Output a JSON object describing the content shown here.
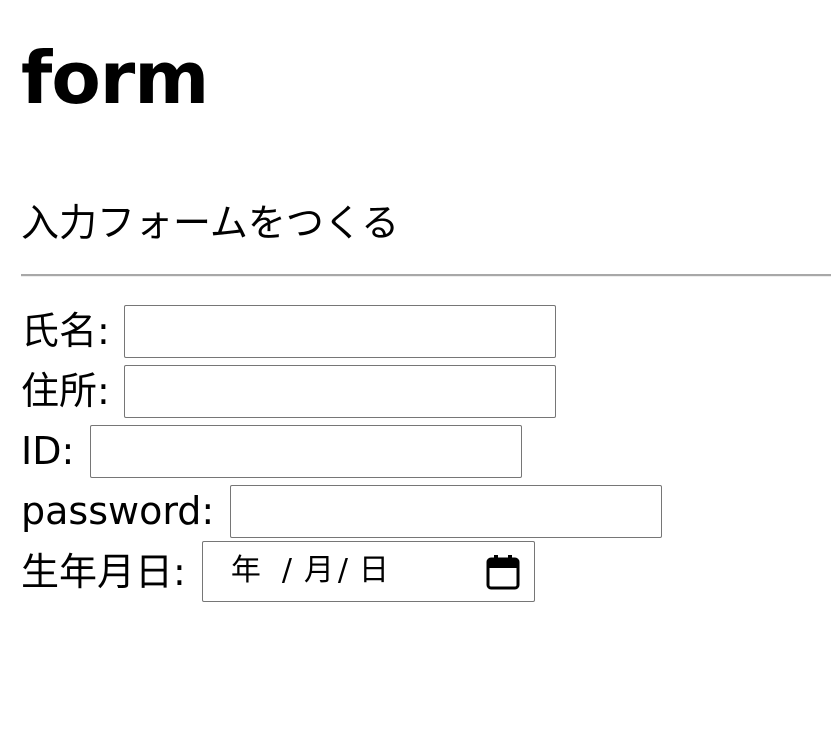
{
  "heading": "form",
  "subtitle": "入力フォームをつくる",
  "form": {
    "name_label": "氏名:",
    "address_label": "住所:",
    "id_label": "ID:",
    "password_label": "password:",
    "birthdate_label": "生年月日:",
    "name_value": "",
    "address_value": "",
    "id_value": "",
    "password_value": "",
    "date_year": "年",
    "date_sep1": "/",
    "date_month": "月",
    "date_sep2": "/",
    "date_day": "日",
    "calendar_icon": "calendar-icon"
  },
  "colors": {
    "rule": "#a8a8a8",
    "field_border": "#767676"
  }
}
